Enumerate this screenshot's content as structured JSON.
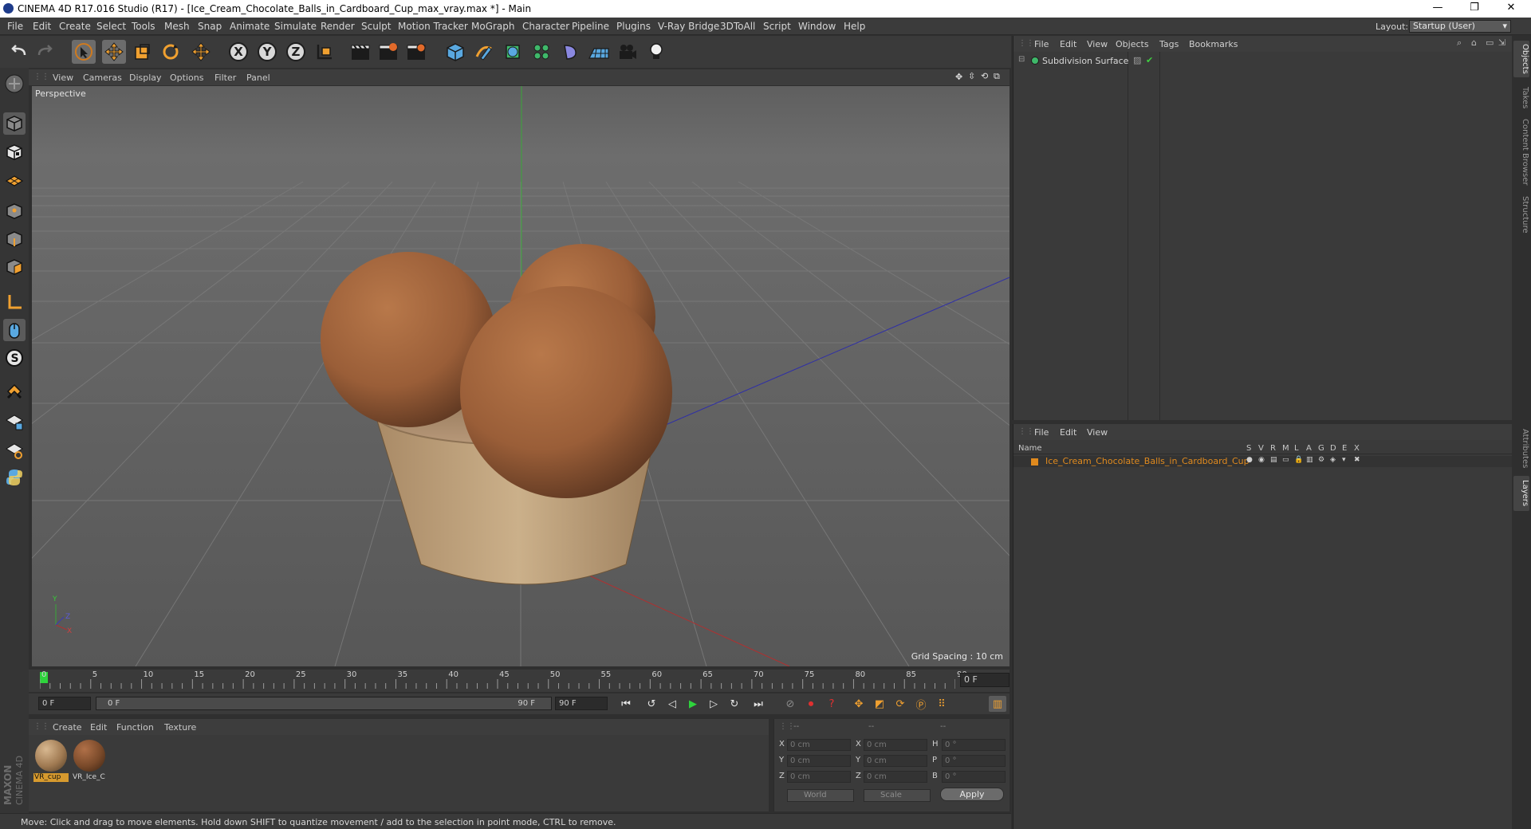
{
  "window": {
    "title": "CINEMA 4D R17.016 Studio (R17) - [Ice_Cream_Chocolate_Balls_in_Cardboard_Cup_max_vray.max *] - Main",
    "minimize": "—",
    "restore": "❐",
    "close": "✕"
  },
  "menubar": {
    "items": [
      "File",
      "Edit",
      "Create",
      "Select",
      "Tools",
      "Mesh",
      "Snap",
      "Animate",
      "Simulate",
      "Render",
      "Sculpt",
      "Motion Tracker",
      "MoGraph",
      "Character",
      "Pipeline",
      "Plugins",
      "V-Ray Bridge",
      "3DToAll",
      "Script",
      "Window",
      "Help"
    ],
    "layout_label": "Layout:",
    "layout_value": "Startup (User)"
  },
  "toolbar": {
    "axis_x": "X",
    "axis_y": "Y",
    "axis_z": "Z"
  },
  "viewport": {
    "menu": [
      "View",
      "Cameras",
      "Display",
      "Options",
      "Filter",
      "Panel"
    ],
    "camera_label": "Perspective",
    "grid_spacing": "Grid Spacing : 10 cm",
    "axis_y_label": "Y",
    "axis_x_label": "X",
    "axis_z_label": "Z"
  },
  "timeline": {
    "ticks": [
      "0",
      "5",
      "10",
      "15",
      "20",
      "25",
      "30",
      "35",
      "40",
      "45",
      "50",
      "55",
      "60",
      "65",
      "70",
      "75",
      "80",
      "85",
      "90"
    ],
    "current_frame": "0 F",
    "start_field": "0 F",
    "range_start": "0 F",
    "range_end": "90 F",
    "end_field": "90 F"
  },
  "materials": {
    "menu": [
      "Create",
      "Edit",
      "Function",
      "Texture"
    ],
    "items": [
      {
        "label": "VR_cup",
        "color": "#a07a52"
      },
      {
        "label": "VR_Ice_C",
        "color": "#7a4a2a"
      }
    ]
  },
  "coords": {
    "headers": [
      "--",
      "--",
      "--"
    ],
    "rows": [
      {
        "l1": "X",
        "v1": "0 cm",
        "l2": "X",
        "v2": "0 cm",
        "l3": "H",
        "v3": "0 °"
      },
      {
        "l1": "Y",
        "v1": "0 cm",
        "l2": "Y",
        "v2": "0 cm",
        "l3": "P",
        "v3": "0 °"
      },
      {
        "l1": "Z",
        "v1": "0 cm",
        "l2": "Z",
        "v2": "0 cm",
        "l3": "B",
        "v3": "0 °"
      }
    ],
    "world": "World",
    "scale": "Scale",
    "apply": "Apply"
  },
  "brand": {
    "line1": "MAXON",
    "line2": "CINEMA 4D"
  },
  "status": "Move: Click and drag to move elements. Hold down SHIFT to quantize movement / add to the selection in point mode, CTRL to remove.",
  "objects_panel": {
    "menu": [
      "File",
      "Edit",
      "View",
      "Objects",
      "Tags",
      "Bookmarks"
    ],
    "item": "Subdivision Surface"
  },
  "layers_panel": {
    "menu": [
      "File",
      "Edit",
      "View"
    ],
    "name_header": "Name",
    "columns": [
      "S",
      "V",
      "R",
      "M",
      "L",
      "A",
      "G",
      "D",
      "E",
      "X"
    ],
    "item": "Ice_Cream_Chocolate_Balls_in_Cardboard_Cup",
    "item_color": "#e08a1e"
  },
  "side_tabs": [
    "Objects",
    "Takes",
    "Content Browser",
    "Structure",
    "Attributes",
    "Layers"
  ]
}
